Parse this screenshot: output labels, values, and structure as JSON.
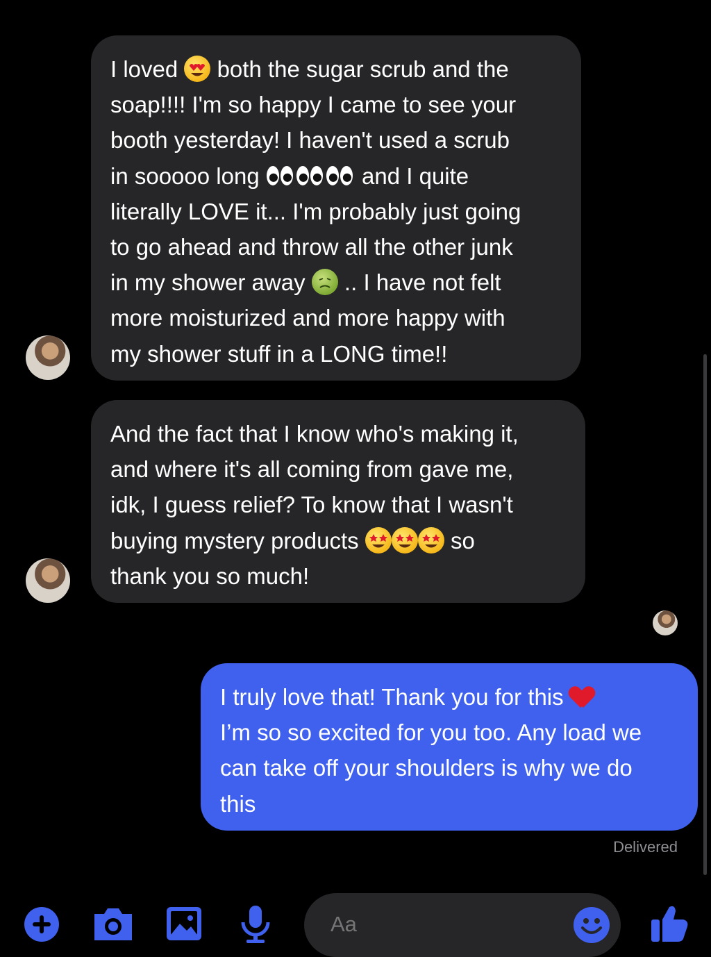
{
  "messages": [
    {
      "direction": "incoming",
      "lines": [
        [
          "I loved ",
          {
            "emoji": "heart-eyes"
          },
          " both the sugar scrub and the"
        ],
        [
          "soap!!!! I'm so happy I came to see your"
        ],
        [
          "booth yesterday! I haven't used a scrub"
        ],
        [
          "in sooooo long ",
          {
            "emoji": "eyes"
          },
          {
            "emoji": "eyes"
          },
          {
            "emoji": "eyes"
          },
          " and I quite"
        ],
        [
          "literally LOVE it... I'm probably just going"
        ],
        [
          "to go ahead and throw all the other junk"
        ],
        [
          "in my shower away ",
          {
            "emoji": "nauseated-face"
          },
          " .. I have not felt"
        ],
        [
          "more moisturized and more happy with"
        ],
        [
          "my shower stuff in a LONG time!!"
        ]
      ]
    },
    {
      "direction": "incoming",
      "lines": [
        [
          "And the fact that I know who's making it,"
        ],
        [
          "and where it's all coming from gave me,"
        ],
        [
          "idk, I guess relief? To know that I wasn't"
        ],
        [
          "buying mystery products ",
          {
            "emoji": "star-struck"
          },
          {
            "emoji": "star-struck"
          },
          {
            "emoji": "star-struck"
          },
          " so"
        ],
        [
          "thank you so much!"
        ]
      ]
    },
    {
      "direction": "outgoing",
      "lines": [
        [
          "I truly love that! Thank you for this ",
          {
            "emoji": "red-heart"
          }
        ],
        [
          "I’m so so excited for you too. Any load we"
        ],
        [
          "can take off your shoulders is why we do"
        ],
        [
          "this"
        ]
      ]
    }
  ],
  "status": {
    "delivered": "Delivered"
  },
  "composer": {
    "placeholder": "Aa"
  },
  "toolbar": {
    "icons": [
      "plus-icon",
      "camera-icon",
      "image-icon",
      "microphone-icon",
      "emoji-icon",
      "thumbs-up-icon"
    ],
    "accent_color": "#3f61ee"
  },
  "colors": {
    "incoming_bubble": "#262628",
    "outgoing_bubble": "#3f61ee",
    "background": "#000000"
  }
}
